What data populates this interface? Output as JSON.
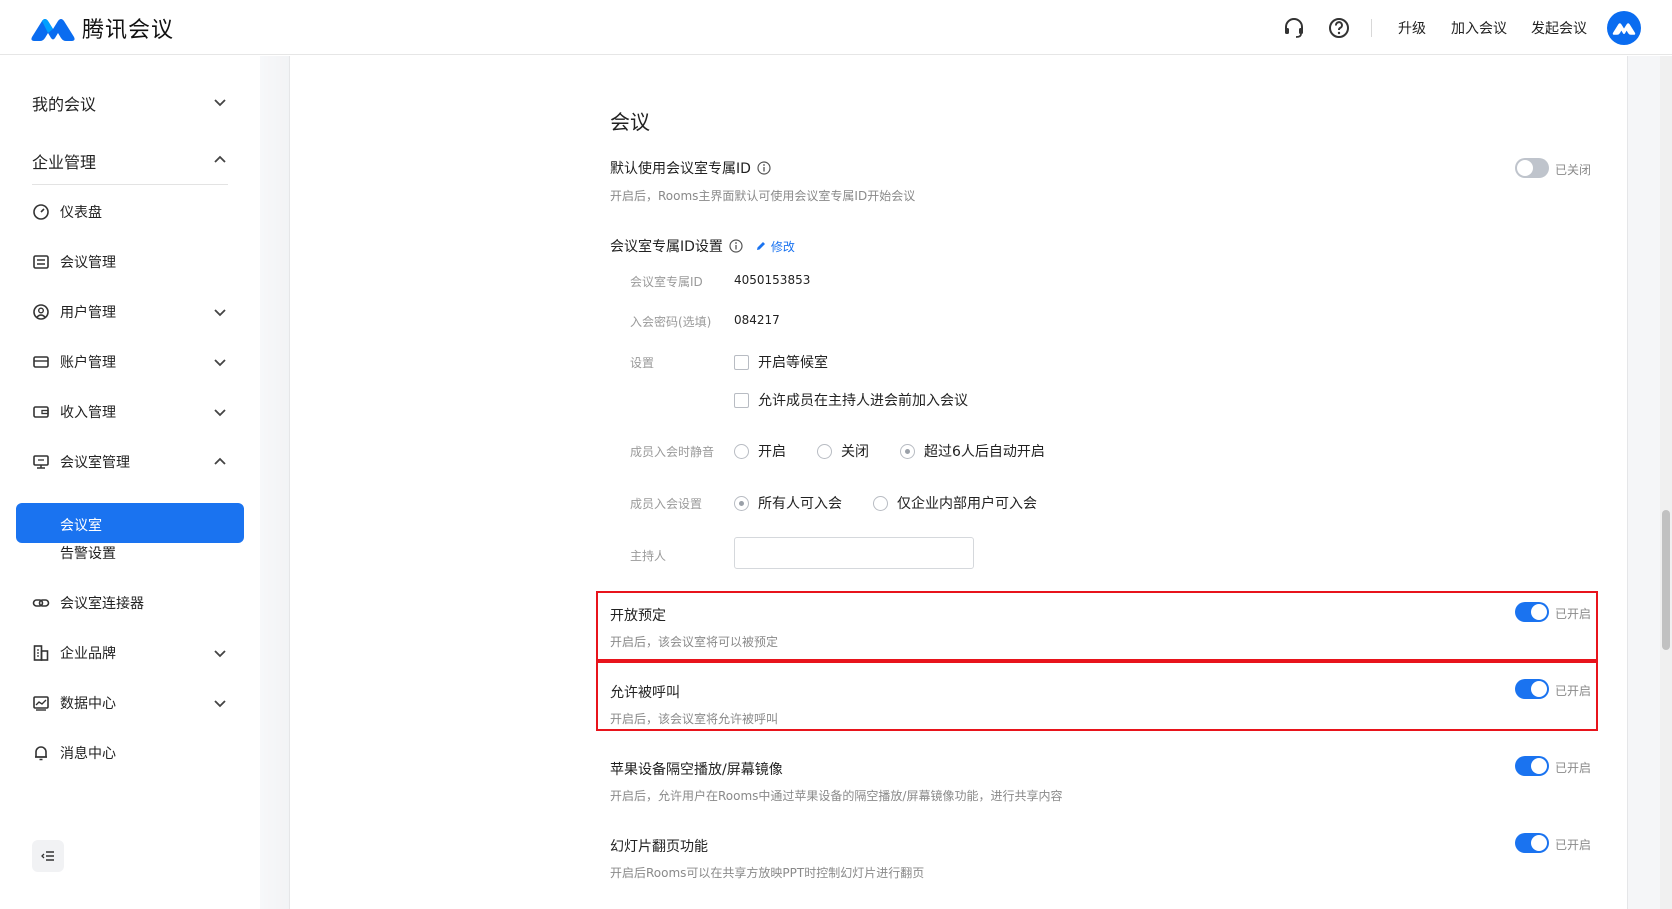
{
  "header": {
    "brand": "腾讯会议",
    "links": {
      "upgrade": "升级",
      "join": "加入会议",
      "start": "发起会议"
    },
    "icons": [
      "headset-icon",
      "help-icon"
    ],
    "brand_color": "#0a6cf0"
  },
  "sidebar": {
    "my_meetings": "我的会议",
    "enterprise": "企业管理",
    "items": {
      "dashboard": "仪表盘",
      "meeting_mgmt": "会议管理",
      "user_mgmt": "用户管理",
      "account_mgmt": "账户管理",
      "revenue_mgmt": "收入管理",
      "room_mgmt": "会议室管理",
      "room": "会议室",
      "alert": "告警设置",
      "connector": "会议室连接器",
      "brand": "企业品牌",
      "data_center": "数据中心",
      "message_center": "消息中心"
    },
    "active_color": "#1a73f0"
  },
  "content": {
    "section_title": "会议",
    "default_id": {
      "label": "默认使用会议室专属ID",
      "desc": "开启后，Rooms主界面默认可使用会议室专属ID开始会议",
      "state": "已关闭"
    },
    "id_settings": {
      "label": "会议室专属ID设置",
      "edit": "修改",
      "room_id_label": "会议室专属ID",
      "room_id_value": "4050153853",
      "password_label": "入会密码(选填)",
      "password_value": "084217",
      "settings_label": "设置",
      "opt_waiting_room": "开启等候室",
      "opt_join_before_host": "允许成员在主持人进会前加入会议",
      "mute_label": "成员入会时静音",
      "mute_on": "开启",
      "mute_off": "关闭",
      "mute_auto": "超过6人后自动开启",
      "join_label": "成员入会设置",
      "join_all": "所有人可入会",
      "join_internal": "仅企业内部用户可入会",
      "host_label": "主持人",
      "host_value": ""
    },
    "booking": {
      "label": "开放预定",
      "desc": "开启后，该会议室将可以被预定",
      "state": "已开启"
    },
    "callable": {
      "label": "允许被呼叫",
      "desc": "开启后，该会议室将允许被呼叫",
      "state": "已开启"
    },
    "airplay": {
      "label": "苹果设备隔空播放/屏幕镜像",
      "desc": "开启后，允许用户在Rooms中通过苹果设备的隔空播放/屏幕镜像功能，进行共享内容",
      "state": "已开启"
    },
    "slides": {
      "label": "幻灯片翻页功能",
      "desc": "开启后Rooms可以在共享方放映PPT时控制幻灯片进行翻页",
      "state": "已开启"
    },
    "highlight_color": "#e8141c"
  }
}
